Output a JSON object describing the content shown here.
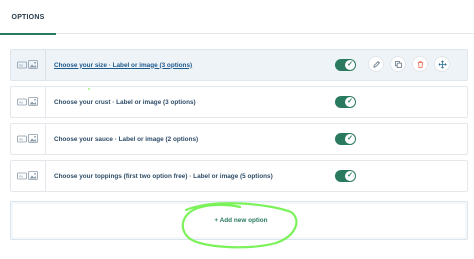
{
  "tabs": [
    {
      "label": "OPTIONS",
      "active": true
    }
  ],
  "options": [
    {
      "label": "Choose your size · Label or image (3 options)",
      "enabled": true,
      "hover": true
    },
    {
      "label": "Choose your crust · Label or image (3 options)",
      "enabled": true,
      "hover": false
    },
    {
      "label": "Choose your sauce · Label or image (2 options)",
      "enabled": true,
      "hover": false
    },
    {
      "label": "Choose your toppings (first two option free) · Label or image (5 options)",
      "enabled": true,
      "hover": false
    }
  ],
  "row_actions": [
    "pencil-icon",
    "copy-icon",
    "trash-icon",
    "move-icon"
  ],
  "add_option_label": "+ Add new option",
  "colors": {
    "accent": "#2a7a5f",
    "highlight_scribble": "#7cf25a",
    "delete": "#e8694a"
  }
}
